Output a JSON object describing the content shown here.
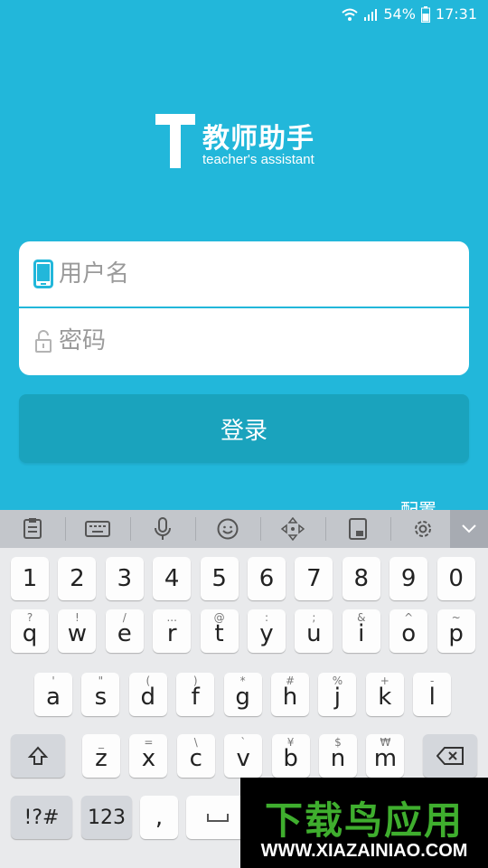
{
  "status_bar": {
    "battery": "54%",
    "time": "17:31",
    "icons": [
      "wifi-icon",
      "signal-icon",
      "battery-icon"
    ]
  },
  "app": {
    "logo_letter": "T",
    "title": "教师助手",
    "subtitle": "teacher's assistant",
    "accent_color": "#22b7da"
  },
  "login": {
    "username_placeholder": "用户名",
    "password_placeholder": "密码",
    "username_value": "",
    "password_value": "",
    "submit_label": "登录",
    "config_label": "配置"
  },
  "keyboard": {
    "toolbar_icons": [
      "clipboard-icon",
      "keyboard-icon",
      "microphone-icon",
      "emoji-icon",
      "cursor-move-icon",
      "one-hand-icon",
      "settings-icon",
      "chevron-down-icon"
    ],
    "row_numbers": [
      "1",
      "2",
      "3",
      "4",
      "5",
      "6",
      "7",
      "8",
      "9",
      "0"
    ],
    "row_q": [
      {
        "k": "q",
        "alt": "?"
      },
      {
        "k": "w",
        "alt": "!"
      },
      {
        "k": "e",
        "alt": "/"
      },
      {
        "k": "r",
        "alt": "..."
      },
      {
        "k": "t",
        "alt": "@"
      },
      {
        "k": "y",
        "alt": ":"
      },
      {
        "k": "u",
        "alt": ";"
      },
      {
        "k": "i",
        "alt": "&"
      },
      {
        "k": "o",
        "alt": "^"
      },
      {
        "k": "p",
        "alt": "~"
      }
    ],
    "row_a": [
      {
        "k": "a",
        "alt": "'"
      },
      {
        "k": "s",
        "alt": "\""
      },
      {
        "k": "d",
        "alt": "("
      },
      {
        "k": "f",
        "alt": ")"
      },
      {
        "k": "g",
        "alt": "*"
      },
      {
        "k": "h",
        "alt": "#"
      },
      {
        "k": "j",
        "alt": "%"
      },
      {
        "k": "k",
        "alt": "+"
      },
      {
        "k": "l",
        "alt": "-"
      }
    ],
    "row_z": [
      {
        "k": "z",
        "alt": "_"
      },
      {
        "k": "x",
        "alt": "="
      },
      {
        "k": "c",
        "alt": "\\"
      },
      {
        "k": "v",
        "alt": "`"
      },
      {
        "k": "b",
        "alt": "¥"
      },
      {
        "k": "n",
        "alt": "$"
      },
      {
        "k": "m",
        "alt": "₩"
      }
    ],
    "symbols_label": "!?#",
    "numbers_label": "123",
    "comma_label": ","
  },
  "watermark": {
    "title": "下载鸟应用",
    "url": "WWW.XIAZAINIAO.COM"
  }
}
